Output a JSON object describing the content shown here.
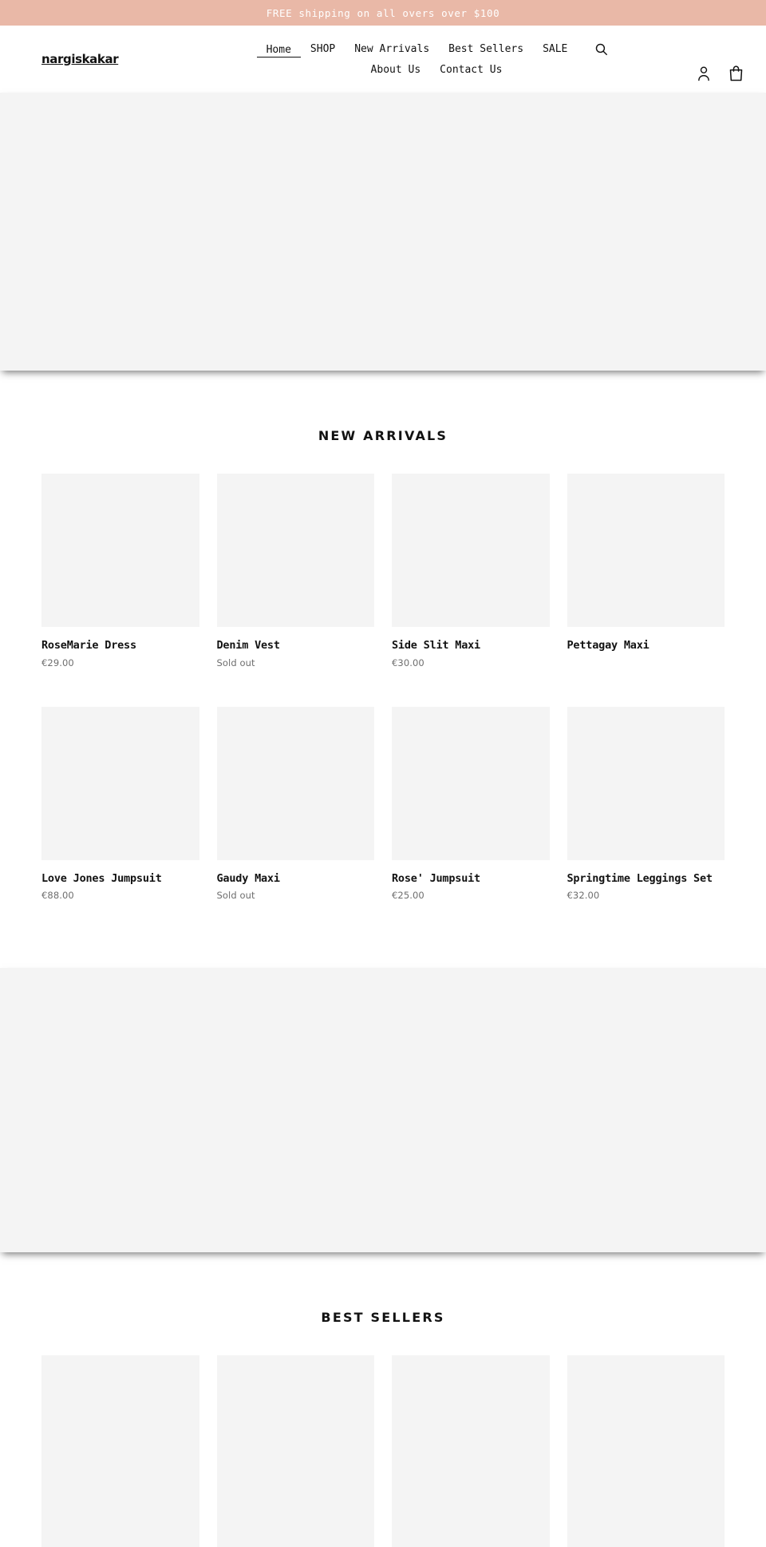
{
  "announcement": {
    "text": "FREE shipping on all overs over $100",
    "background": "#e9b8a7",
    "text_color": "#ffffff"
  },
  "header": {
    "logo": "nargiskakar",
    "nav_row_1": [
      {
        "label": "Home",
        "active": true
      },
      {
        "label": "SHOP",
        "active": false
      },
      {
        "label": "New Arrivals",
        "active": false
      },
      {
        "label": "Best Sellers",
        "active": false
      },
      {
        "label": "SALE",
        "active": false
      }
    ],
    "nav_row_2": [
      {
        "label": "About Us",
        "active": false
      },
      {
        "label": "Contact Us",
        "active": false
      }
    ],
    "icons": {
      "search": "search-icon",
      "account": "account-icon",
      "cart": "cart-icon"
    }
  },
  "sections": [
    {
      "id": "new-arrivals",
      "title": "NEW ARRIVALS",
      "products": [
        {
          "title": "RoseMarie Dress",
          "price": "€29.00"
        },
        {
          "title": "Denim Vest",
          "price": "Sold out"
        },
        {
          "title": "Side Slit Maxi",
          "price": "€30.00"
        },
        {
          "title": "Pettagay Maxi",
          "price": ""
        },
        {
          "title": "Love Jones Jumpsuit",
          "price": "€88.00"
        },
        {
          "title": "Gaudy Maxi",
          "price": "Sold out"
        },
        {
          "title": "Rose' Jumpsuit",
          "price": "€25.00"
        },
        {
          "title": "Springtime Leggings Set",
          "price": "€32.00"
        }
      ]
    },
    {
      "id": "best-sellers",
      "title": "BEST SELLERS",
      "products": [
        {
          "title": "",
          "price": ""
        },
        {
          "title": "",
          "price": ""
        },
        {
          "title": "",
          "price": ""
        },
        {
          "title": "",
          "price": ""
        }
      ]
    }
  ],
  "colors": {
    "accent": "#e9b8a7",
    "placeholder": "#f4f4f4",
    "text": "#121212",
    "muted": "#6e6e6e"
  }
}
